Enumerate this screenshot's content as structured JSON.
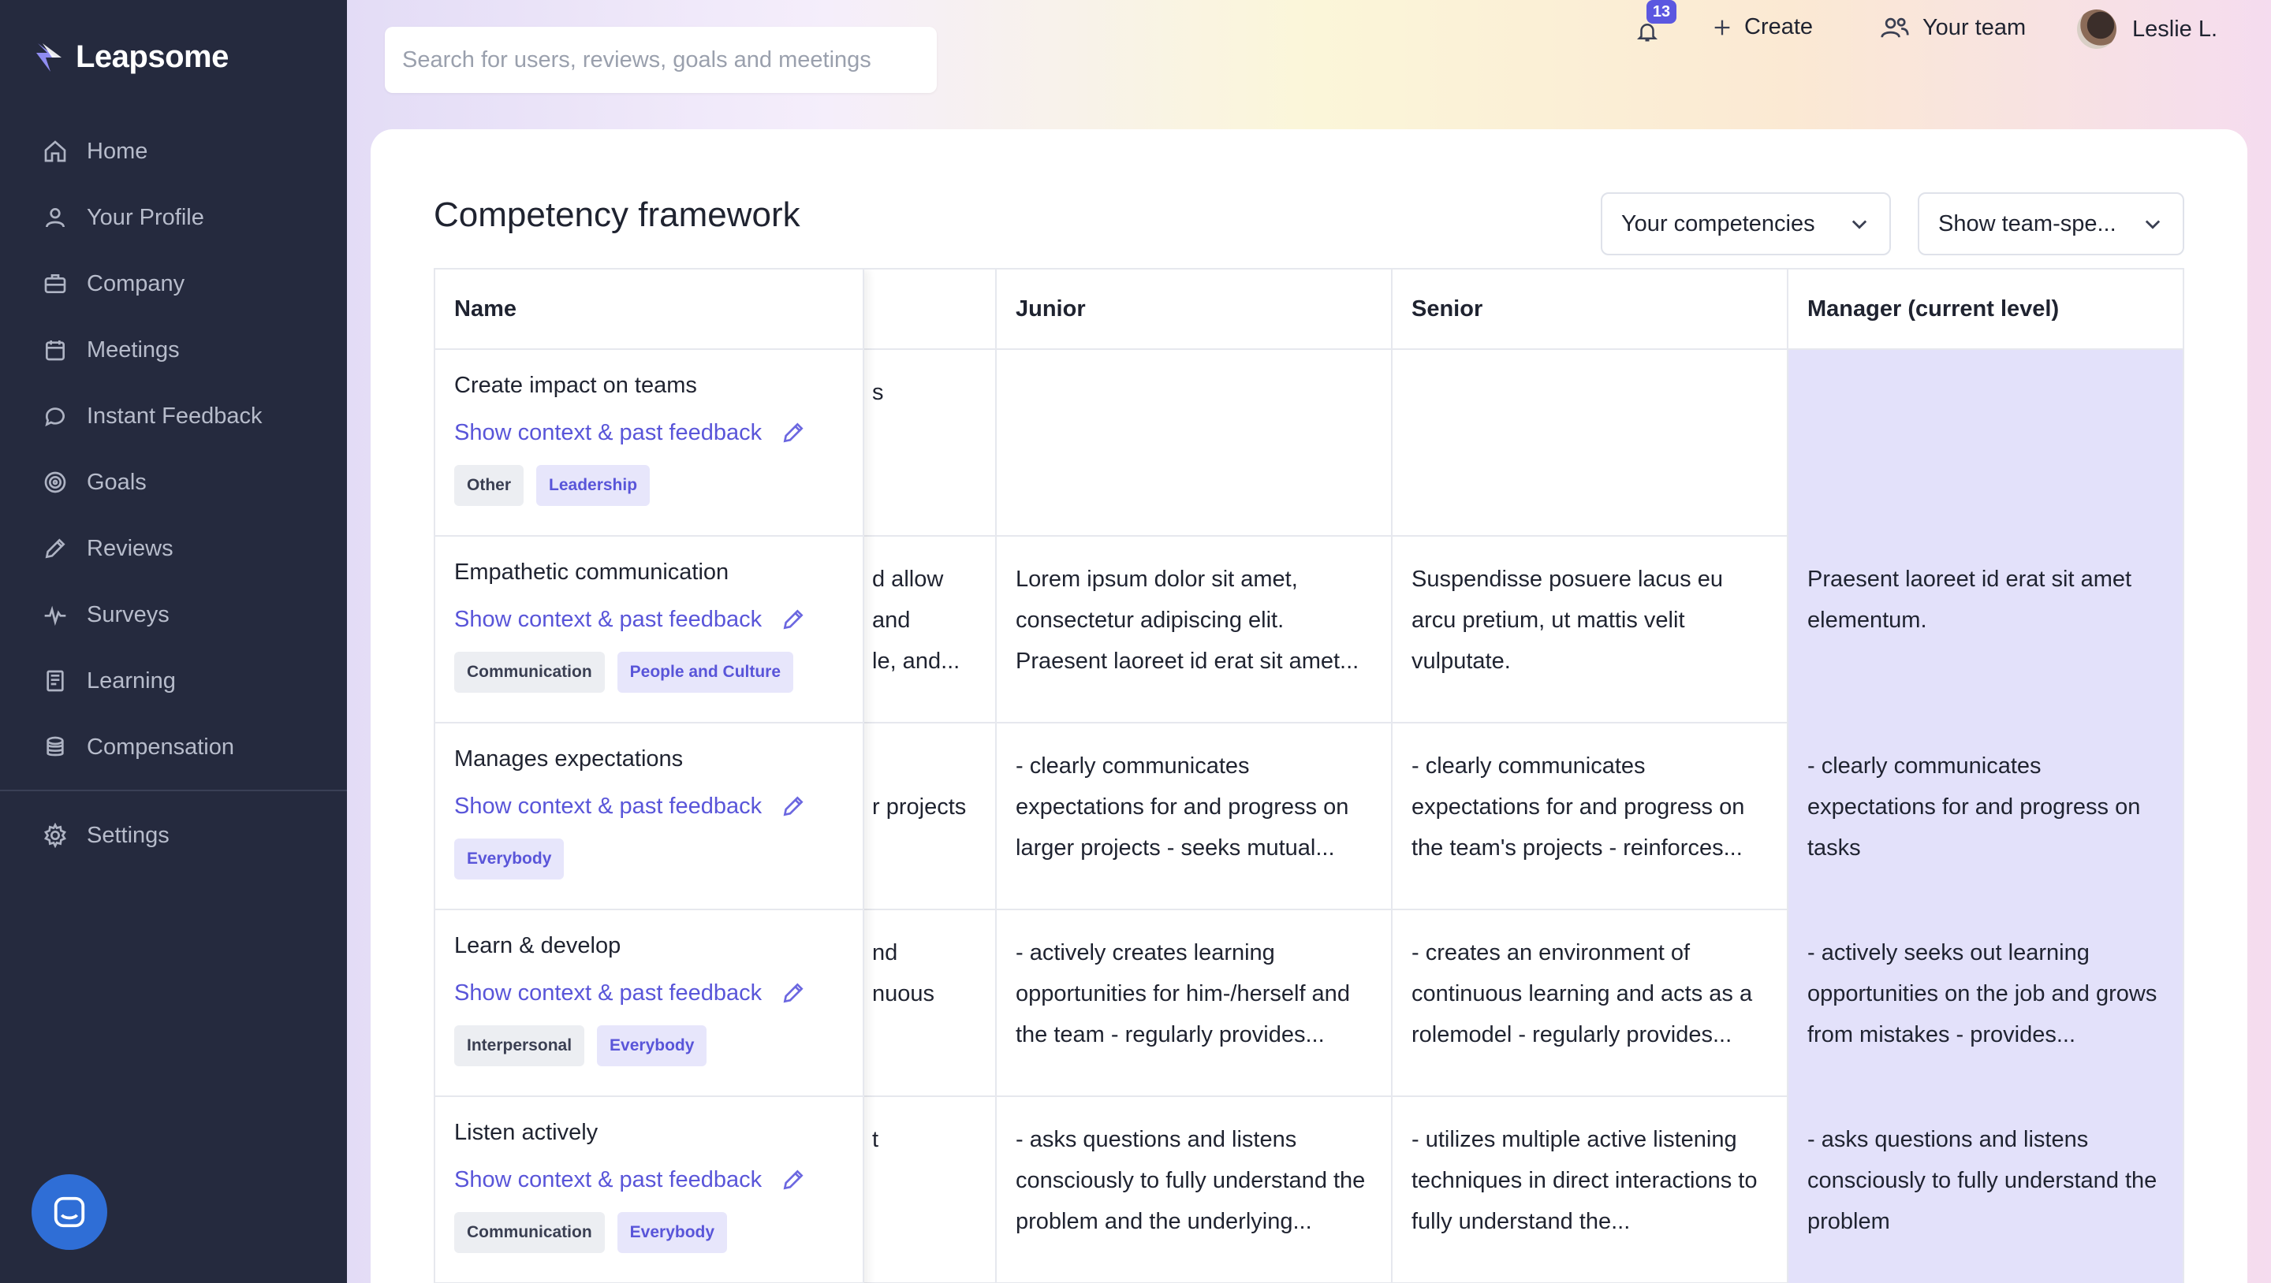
{
  "app": {
    "name": "Leapsome"
  },
  "sidebar": {
    "items": [
      {
        "label": "Home",
        "icon": "home-icon"
      },
      {
        "label": "Your Profile",
        "icon": "user-icon"
      },
      {
        "label": "Company",
        "icon": "briefcase-icon"
      },
      {
        "label": "Meetings",
        "icon": "calendar-icon"
      },
      {
        "label": "Instant Feedback",
        "icon": "chat-icon"
      },
      {
        "label": "Goals",
        "icon": "target-icon"
      },
      {
        "label": "Reviews",
        "icon": "pencil-icon"
      },
      {
        "label": "Surveys",
        "icon": "pulse-icon"
      },
      {
        "label": "Learning",
        "icon": "book-icon"
      },
      {
        "label": "Compensation",
        "icon": "coins-icon"
      }
    ],
    "settings": {
      "label": "Settings",
      "icon": "gear-icon"
    }
  },
  "topbar": {
    "search_placeholder": "Search for users, reviews, goals and meetings",
    "notification_count": "13",
    "create_label": "Create",
    "team_label": "Your team",
    "user_label": "Leslie L."
  },
  "page": {
    "title": "Competency framework",
    "filter1": "Your competencies",
    "filter2": "Show team-spe..."
  },
  "table": {
    "headers": {
      "name": "Name",
      "junior": "Junior",
      "senior": "Senior",
      "manager": "Manager (current level)"
    },
    "rows": [
      {
        "name": "Create impact on teams",
        "link": "Show context & past feedback",
        "tags": [
          {
            "label": "Other",
            "style": "gray"
          },
          {
            "label": "Leadership",
            "style": "purple"
          }
        ],
        "hidden": "s",
        "junior": "",
        "senior": "",
        "manager": ""
      },
      {
        "name": "Empathetic communication",
        "link": "Show context & past feedback",
        "tags": [
          {
            "label": "Communication",
            "style": "gray"
          },
          {
            "label": "People and Culture",
            "style": "purple"
          }
        ],
        "hidden": "d allow\nand\nle, and...",
        "junior": "Lorem ipsum dolor sit amet, consectetur adipiscing elit. Praesent laoreet id erat sit amet...",
        "senior": "Suspendisse posuere lacus eu arcu pretium, ut mattis velit vulputate.",
        "manager": "Praesent laoreet id erat sit amet elementum."
      },
      {
        "name": "Manages expectations",
        "link": "Show context & past feedback",
        "tags": [
          {
            "label": "Everybody",
            "style": "purple"
          }
        ],
        "hidden": "\nr projects",
        "junior": "- clearly communicates expectations for and progress on larger projects - seeks mutual...",
        "senior": "- clearly communicates expectations for and progress on the team's projects - reinforces...",
        "manager": "- clearly communicates expectations for and progress on tasks"
      },
      {
        "name": "Learn & develop",
        "link": "Show context & past feedback",
        "tags": [
          {
            "label": "Interpersonal",
            "style": "gray"
          },
          {
            "label": "Everybody",
            "style": "purple"
          }
        ],
        "hidden": "nd\nnuous",
        "junior": "- actively creates learning opportunities for him-/herself and the team - regularly provides...",
        "senior": "- creates an environment of continuous learning and acts as a rolemodel - regularly provides...",
        "manager": "- actively seeks out learning opportunities on the job and grows from mistakes - provides..."
      },
      {
        "name": "Listen actively",
        "link": "Show context & past feedback",
        "tags": [
          {
            "label": "Communication",
            "style": "gray"
          },
          {
            "label": "Everybody",
            "style": "purple"
          }
        ],
        "hidden": "t",
        "junior": "- asks questions and listens consciously to fully understand the problem and the underlying...",
        "senior": "- utilizes multiple active listening techniques in direct interactions to fully understand the...",
        "manager": "- asks questions and listens consciously to fully understand the problem"
      }
    ]
  },
  "colors": {
    "sidebar": "#252a3e",
    "accent": "#5955d9",
    "highlight": "#e3e1fa"
  }
}
